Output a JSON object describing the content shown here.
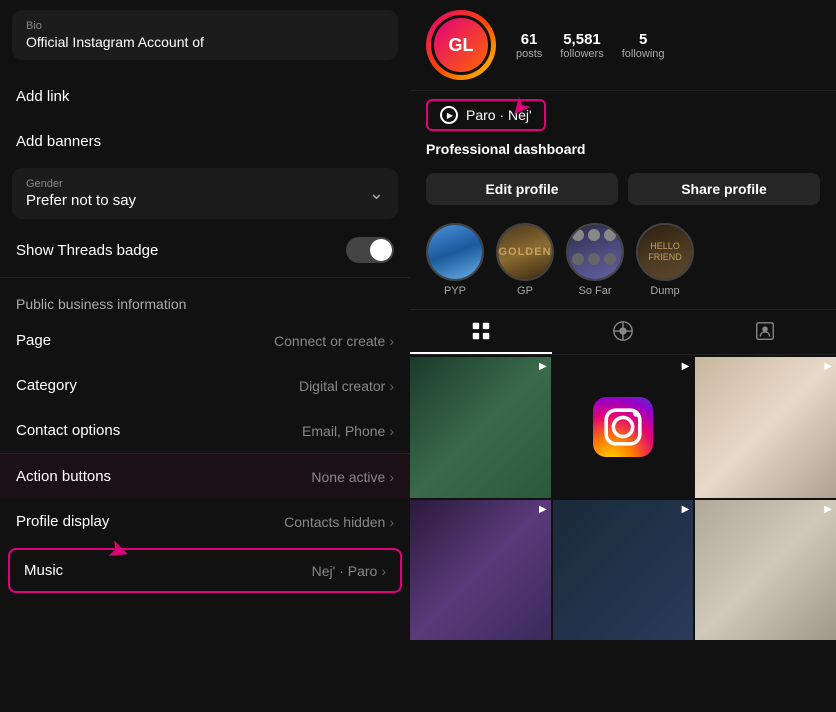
{
  "left": {
    "bio_label": "Bio",
    "bio_text": "Official Instagram Account of",
    "add_link": "Add link",
    "add_banners": "Add banners",
    "gender_label": "Gender",
    "gender_value": "Prefer not to say",
    "show_threads_badge": "Show Threads badge",
    "public_business_info": "Public business information",
    "page_label": "Page",
    "page_value": "Connect or create",
    "category_label": "Category",
    "category_value": "Digital creator",
    "contact_label": "Contact options",
    "contact_value": "Email, Phone",
    "action_buttons_label": "Action buttons",
    "action_buttons_value": "None active",
    "profile_display_label": "Profile display",
    "profile_display_value": "Contacts hidden",
    "music_label": "Music",
    "music_value": "Nej' · Paro"
  },
  "right": {
    "stat1_number": "61",
    "stat1_label": "posts",
    "stat2_number": "5,581",
    "stat2_label": "followers",
    "stat3_number": "5",
    "stat3_label": "following",
    "profile_name": "Paro · Nej'",
    "pro_dashboard": "Professional dashboard",
    "edit_profile": "Edit profile",
    "share_profile": "Share profile",
    "highlight1_label": "PYP",
    "highlight2_label": "GP",
    "highlight3_label": "So Far",
    "highlight4_label": "Dump"
  }
}
